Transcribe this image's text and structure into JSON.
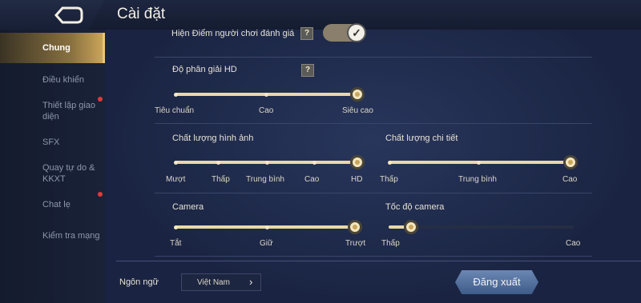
{
  "header": {
    "title": "Cài đặt",
    "back_icon": "back-arrow-icon"
  },
  "sidebar": {
    "items": [
      {
        "label": "Chung",
        "active": true,
        "badge": false
      },
      {
        "label": "Điều khiển",
        "active": false,
        "badge": false
      },
      {
        "label": "Thiết lập giao diện",
        "active": false,
        "badge": true
      },
      {
        "label": "SFX",
        "active": false,
        "badge": false
      },
      {
        "label": "Quay tự do & KKXT",
        "active": false,
        "badge": false
      },
      {
        "label": "Chat lẹ",
        "active": false,
        "badge": true
      },
      {
        "label": "Kiểm tra mạng",
        "active": false,
        "badge": false
      }
    ]
  },
  "settings": {
    "rating": {
      "label": "Hiện Điểm người chơi đánh giá",
      "help": "?",
      "enabled": true
    },
    "resolution": {
      "label": "Độ phân giải HD",
      "help": "?",
      "options": [
        "Tiêu chuẩn",
        "Cao",
        "Siêu cao"
      ],
      "selected": "Siêu cao"
    },
    "image_quality": {
      "label": "Chất lượng hình ảnh",
      "options": [
        "Mượt",
        "Thấp",
        "Trung bình",
        "Cao",
        "HD"
      ],
      "selected": "HD"
    },
    "detail_quality": {
      "label": "Chất lượng chi tiết",
      "options": [
        "Thấp",
        "Trung bình",
        "Cao"
      ],
      "selected": "Cao"
    },
    "camera": {
      "label": "Camera",
      "options": [
        "Tắt",
        "Giữ",
        "Trượt"
      ],
      "selected": "Trượt"
    },
    "camera_speed": {
      "label": "Tốc độ camera",
      "min_label": "Thấp",
      "max_label": "Cao",
      "value": 0.12
    }
  },
  "footer": {
    "language_label": "Ngôn ngữ",
    "language_value": "Việt Nam",
    "logout_label": "Đăng xuất"
  },
  "colors": {
    "accent": "#e9d9a8",
    "active_nav": "#caa45a",
    "badge": "#e03a3a"
  }
}
